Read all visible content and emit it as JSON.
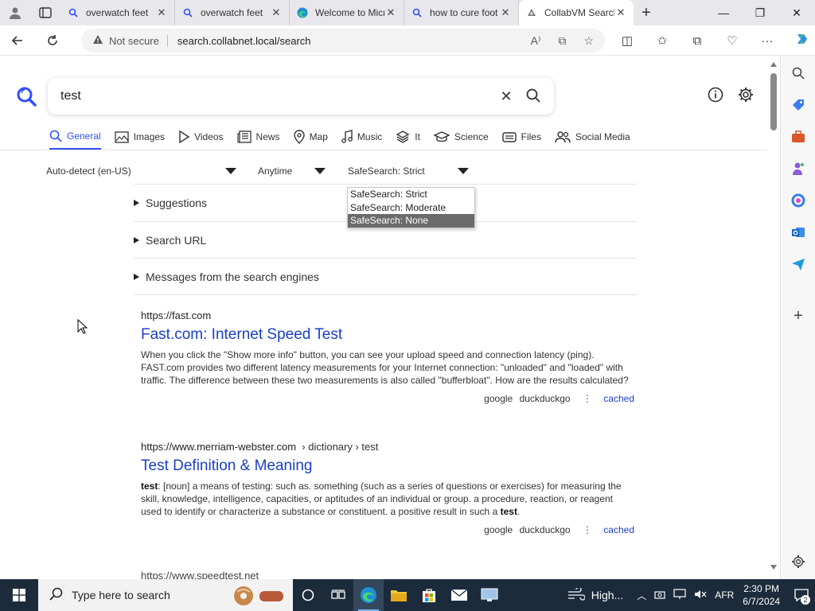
{
  "browser": {
    "tabs": [
      {
        "title": "overwatch feet",
        "icon": "search-icon",
        "active": false
      },
      {
        "title": "overwatch feet",
        "icon": "search-icon",
        "active": false
      },
      {
        "title": "Welcome to Microsoft Edge",
        "icon": "edge-icon",
        "active": false
      },
      {
        "title": "how to cure foot",
        "icon": "search-icon",
        "active": false
      },
      {
        "title": "CollabVM Search",
        "icon": "collabvm-icon",
        "active": true
      }
    ],
    "security_label": "Not secure",
    "url": "search.collabnet.local/search"
  },
  "search": {
    "query": "test",
    "categories": [
      {
        "label": "General",
        "icon": "search-icon",
        "active": true
      },
      {
        "label": "Images",
        "icon": "image-icon"
      },
      {
        "label": "Videos",
        "icon": "play-icon"
      },
      {
        "label": "News",
        "icon": "newspaper-icon"
      },
      {
        "label": "Map",
        "icon": "map-pin-icon"
      },
      {
        "label": "Music",
        "icon": "music-note-icon"
      },
      {
        "label": "It",
        "icon": "layers-icon"
      },
      {
        "label": "Science",
        "icon": "mortarboard-icon"
      },
      {
        "label": "Files",
        "icon": "file-icon"
      },
      {
        "label": "Social Media",
        "icon": "people-icon"
      }
    ],
    "filters": {
      "language": "Auto-detect (en-US)",
      "time": "Anytime",
      "safesearch": "SafeSearch: Strict"
    },
    "safesearch_options": [
      "SafeSearch: Strict",
      "SafeSearch: Moderate",
      "SafeSearch: None"
    ],
    "safesearch_highlighted": "SafeSearch: None",
    "sections": [
      "Suggestions",
      "Search URL",
      "Messages from the search engines"
    ]
  },
  "results": [
    {
      "url": "https://fast.com",
      "breadcrumb": "",
      "title": "Fast.com: Internet Speed Test",
      "desc_bold": "",
      "desc": "When you click the \"Show more info\" button, you can see your upload speed and connection latency (ping). FAST.com provides two different latency measurements for your Internet connection: \"unloaded\" and \"loaded\" with traffic. The difference between these two measurements is also called \"bufferbloat\". How are the results calculated?",
      "engines": [
        "google",
        "duckduckgo"
      ],
      "cached": "cached"
    },
    {
      "url": "https://www.merriam-webster.com",
      "breadcrumb": "› dictionary › test",
      "title": "Test Definition & Meaning",
      "desc_bold": "test",
      "desc": ": [noun] a means of testing: such as. something (such as a series of questions or exercises) for measuring the skill, knowledge, intelligence, capacities, or aptitudes of an individual or group. a procedure, reaction, or reagent used to identify or characterize a substance or constituent. a positive result in such a",
      "desc_bold_end": "test",
      "desc_end": ".",
      "engines": [
        "google",
        "duckduckgo"
      ],
      "cached": "cached"
    }
  ],
  "next_result_url": "https://www.speedtest.net",
  "taskbar": {
    "search_placeholder": "Type here to search",
    "weather": "High...",
    "language": "AFR",
    "time": "2:30 PM",
    "date": "6/7/2024",
    "notification_count": "2"
  },
  "colors": {
    "accent": "#3050ff",
    "link": "#1a3fc6",
    "taskbar": "#1c2b3c"
  }
}
